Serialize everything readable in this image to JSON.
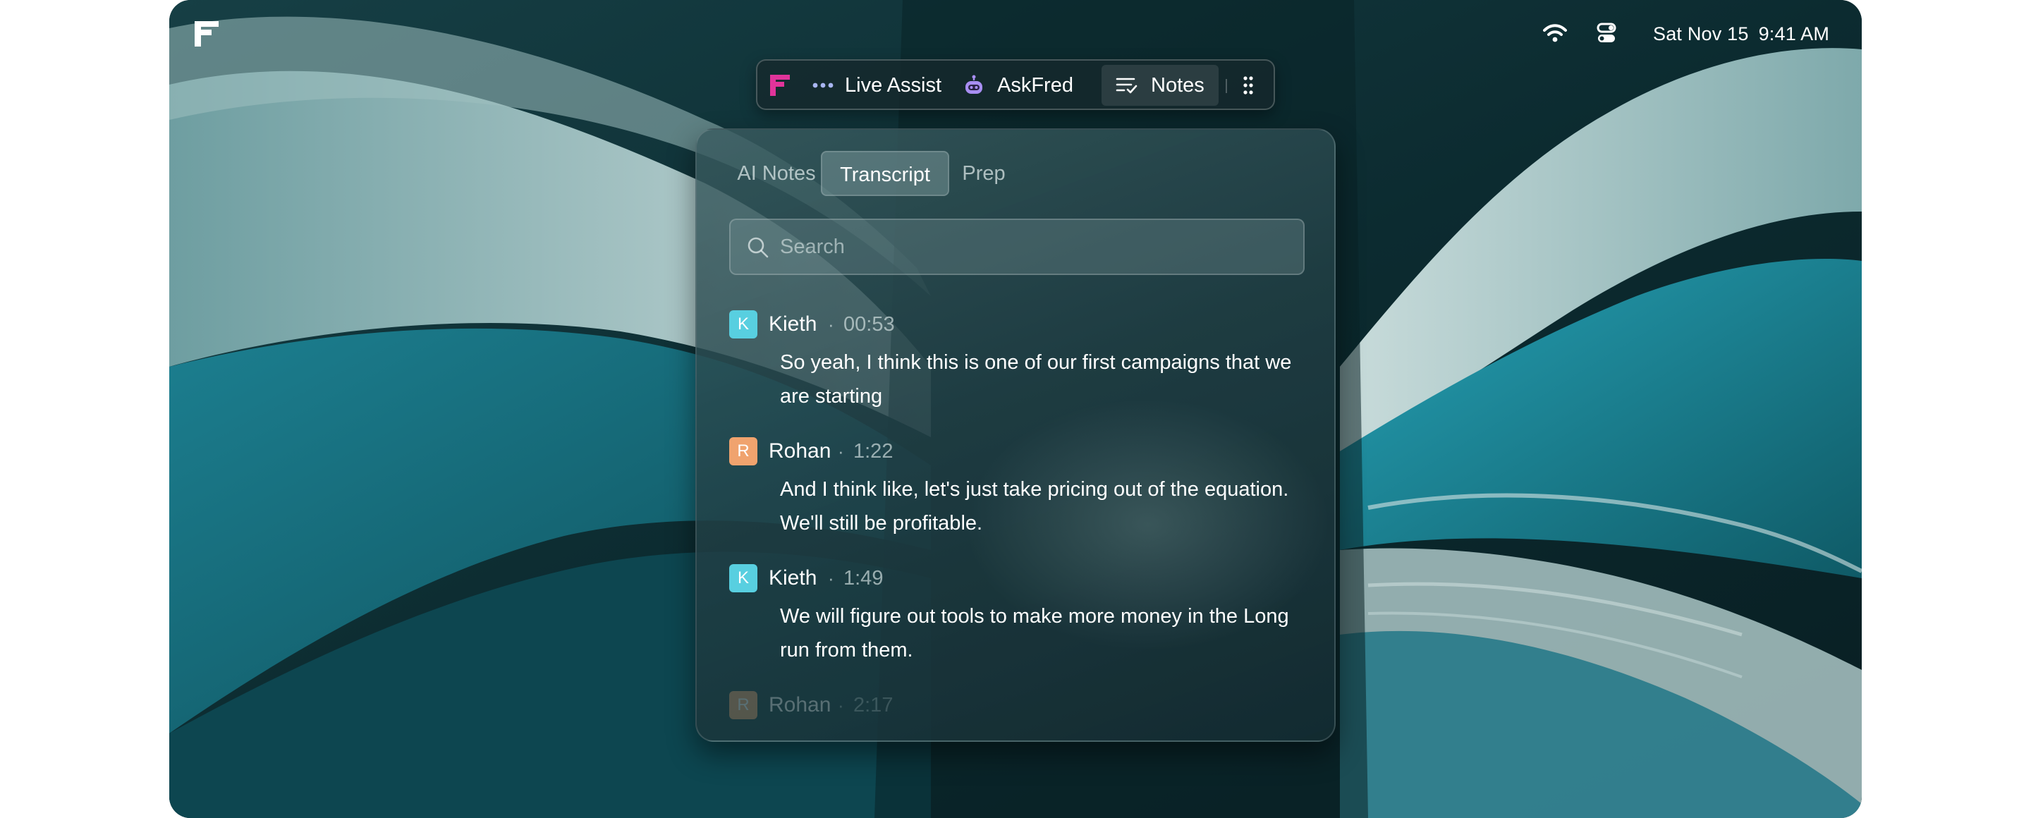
{
  "menubar": {
    "date": "Sat Nov 15",
    "time": "9:41 AM",
    "icons": [
      "app-logo-icon",
      "wifi-icon",
      "control-center-icon"
    ]
  },
  "toolbar": {
    "items": [
      {
        "label": "Live Assist",
        "icon": "more-dots-icon"
      },
      {
        "label": "AskFred",
        "icon": "robot-icon"
      },
      {
        "label": "Notes",
        "icon": "notes-list-icon",
        "active": true
      }
    ],
    "grip_icon": "drag-grip-icon"
  },
  "panel": {
    "tabs": [
      {
        "label": "AI Notes",
        "active": false
      },
      {
        "label": "Transcript",
        "active": true
      },
      {
        "label": "Prep",
        "active": false
      }
    ],
    "search": {
      "placeholder": "Search",
      "value": ""
    },
    "transcript": [
      {
        "initial": "K",
        "speaker": "Kieth",
        "time": "00:53",
        "color": "#58cfe0",
        "text": "So yeah, I think this is one of our first campaigns that we are starting"
      },
      {
        "initial": "R",
        "speaker": "Rohan",
        "time": "1:22",
        "color": "#f0a36e",
        "text": "And I think like, let's just take pricing out of the equation. We'll still be profitable."
      },
      {
        "initial": "K",
        "speaker": "Kieth",
        "time": "1:49",
        "color": "#58cfe0",
        "text": "We will figure out tools to make more money in the Long run from them."
      },
      {
        "initial": "R",
        "speaker": "Rohan",
        "time": "2:17",
        "color": "#f0a36e",
        "text": ""
      }
    ]
  },
  "colors": {
    "accent_teal": "#58cfe0",
    "accent_orange": "#f0a36e",
    "brand_pink": "#e0349a",
    "askfred_purple": "#a88ef2"
  }
}
